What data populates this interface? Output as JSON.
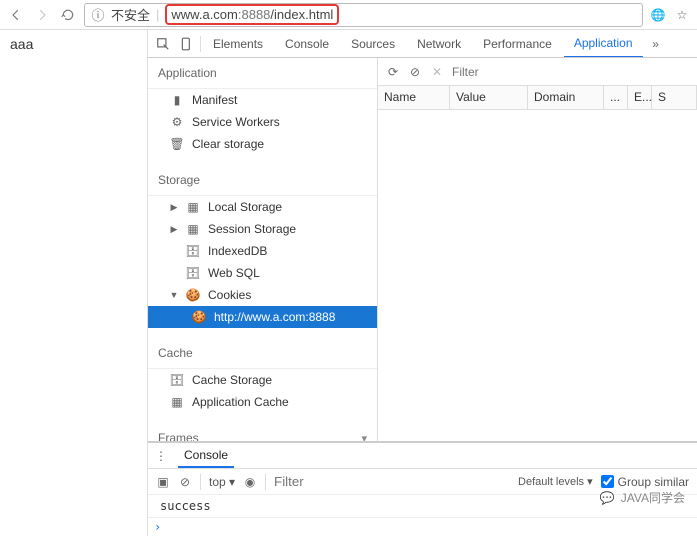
{
  "browser": {
    "insecure_label": "不安全",
    "url_prefix": "www.a.com",
    "url_port": ":8888",
    "url_path": "/index.html"
  },
  "page": {
    "content": "aaa"
  },
  "devtools": {
    "tabs": [
      "Elements",
      "Console",
      "Sources",
      "Network",
      "Performance",
      "Application"
    ],
    "active_tab": "Application",
    "sidebar": {
      "section_app": "Application",
      "app_items": [
        "Manifest",
        "Service Workers",
        "Clear storage"
      ],
      "section_storage": "Storage",
      "storage_items": {
        "local": "Local Storage",
        "session": "Session Storage",
        "idb": "IndexedDB",
        "websql": "Web SQL",
        "cookies": "Cookies",
        "cookie_origin": "http://www.a.com:8888"
      },
      "section_cache": "Cache",
      "cache_items": [
        "Cache Storage",
        "Application Cache"
      ],
      "section_frames": "Frames"
    },
    "main": {
      "filter_placeholder": "Filter",
      "columns": [
        "Name",
        "Value",
        "Domain",
        "...",
        "E...",
        "S"
      ]
    },
    "drawer": {
      "tab": "Console",
      "context": "top",
      "filter_placeholder": "Filter",
      "levels": "Default levels ▾",
      "group": "Group similar",
      "output": "success"
    }
  },
  "watermark": "JAVA同学会"
}
